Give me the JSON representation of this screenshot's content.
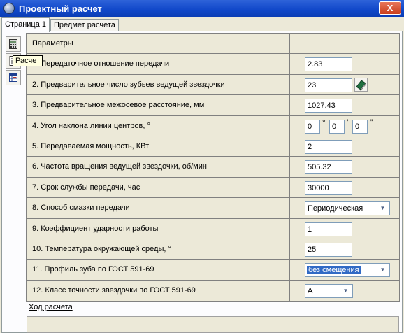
{
  "window": {
    "title": "Проектный расчет",
    "close_label": "X"
  },
  "tabs": [
    {
      "label": "Страница 1",
      "active": true
    },
    {
      "label": "Предмет расчета",
      "active": false
    }
  ],
  "sidebar": {
    "icons": [
      "calculator-icon",
      "document-icon",
      "table-icon"
    ],
    "tooltip": "Расчет"
  },
  "grid": {
    "header": "Параметры",
    "rows": [
      {
        "label": "1. Передаточное отношение передачи",
        "value": "2.83",
        "control": "input"
      },
      {
        "label": "2. Предварительное число зубьев ведущей звездочки",
        "value": "23",
        "control": "input-ref"
      },
      {
        "label": "3. Предварительное межосевое расстояние, мм",
        "value": "1027.43",
        "control": "input"
      },
      {
        "label": "4. Угол наклона линии центров, °",
        "control": "angle",
        "angle": {
          "deg": "0",
          "min": "0",
          "sec": "0",
          "deg_sym": "°",
          "min_sym": "'",
          "sec_sym": "\""
        }
      },
      {
        "label": "5. Передаваемая мощность, КВт",
        "value": "2",
        "control": "input"
      },
      {
        "label": "6. Частота вращения ведущей звездочки, об/мин",
        "value": "505.32",
        "control": "input"
      },
      {
        "label": "7. Срок службы передачи, час",
        "value": "30000",
        "control": "input"
      },
      {
        "label": "8. Способ смазки передачи",
        "value": "Периодическая",
        "control": "select"
      },
      {
        "label": "9. Коэффициент ударности работы",
        "value": "1",
        "control": "input"
      },
      {
        "label": "10. Температура окружающей среды, °",
        "value": "25",
        "control": "input"
      },
      {
        "label": "11. Профиль зуба по ГОСТ 591-69",
        "value": "без смещения",
        "control": "select-highlight"
      },
      {
        "label": "12. Класс точности звездочки по ГОСТ 591-69",
        "value": "А",
        "control": "select-small"
      }
    ]
  },
  "progress_section": {
    "label": "Ход расчета"
  },
  "colors": {
    "titlebar": "#1047c9",
    "panel": "#fcfcfe",
    "cell_bg": "#ece9d8",
    "selection": "#316ac5"
  }
}
